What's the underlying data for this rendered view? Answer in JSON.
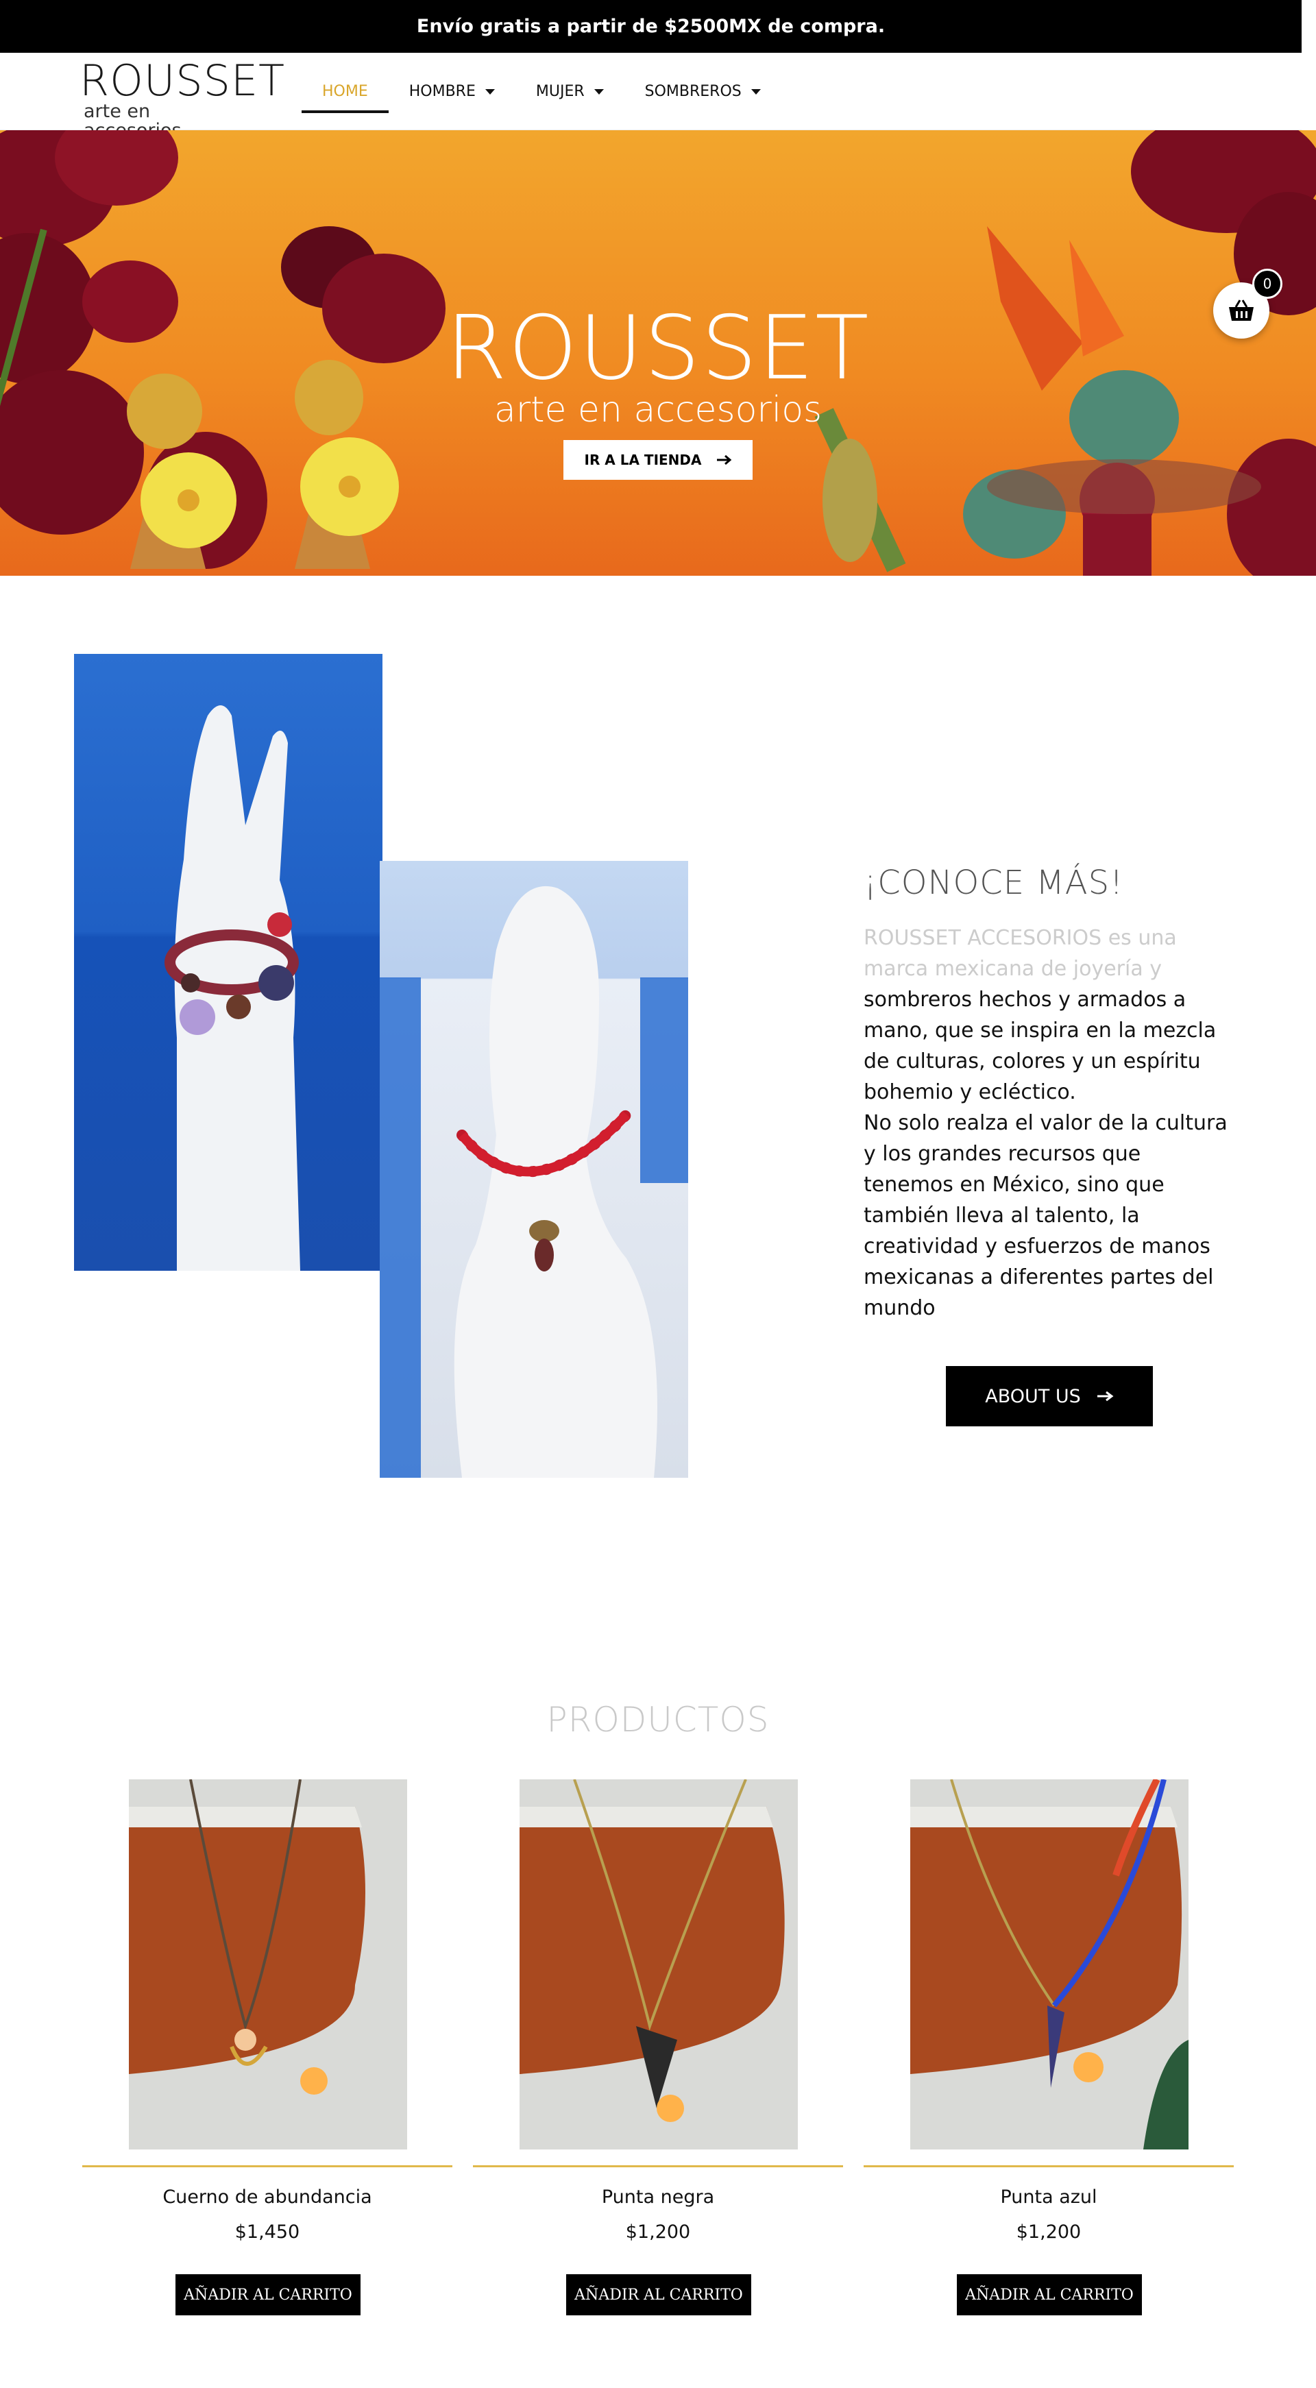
{
  "promo": {
    "text": "Envío gratis a partir de $2500MX de compra."
  },
  "logo": {
    "word": "ROUSSET",
    "sub": "arte en accesorios"
  },
  "nav": {
    "items": [
      {
        "label": "HOME"
      },
      {
        "label": "HOMBRE"
      },
      {
        "label": "MUJER"
      },
      {
        "label": "SOMBREROS"
      }
    ]
  },
  "hero": {
    "title": "ROUSSET",
    "subtitle": "arte en accesorios",
    "button_label": "IR A LA TIENDA"
  },
  "cart": {
    "count": "0"
  },
  "about": {
    "title": "¡CONOCE MÁS!",
    "lead": "ROUSSET ACCESORIOS es una marca mexicana de joyería y",
    "body": "sombreros hechos y armados a mano, que se inspira en la mezcla de culturas, colores y un espíritu bohemio y ecléctico.",
    "body2": "No solo realza el valor de la cultura y los grandes recursos que tenemos en México, sino que también lleva al talento, la creatividad y esfuerzos de manos mexicanas a diferentes partes del mundo",
    "button_label": "ABOUT US"
  },
  "products": {
    "title": "PRODUCTOS",
    "items": [
      {
        "name": "Cuerno de abundancia",
        "price": "$1,450",
        "button": "AÑADIR AL CARRITO"
      },
      {
        "name": "Punta negra",
        "price": "$1,200",
        "button": "AÑADIR AL CARRITO"
      },
      {
        "name": "Punta azul",
        "price": "$1,200",
        "button": "AÑADIR AL CARRITO"
      }
    ]
  },
  "colors": {
    "accent": "#d9a62b",
    "hero_orange": "#f08a22",
    "underline": "#e0b84b"
  }
}
